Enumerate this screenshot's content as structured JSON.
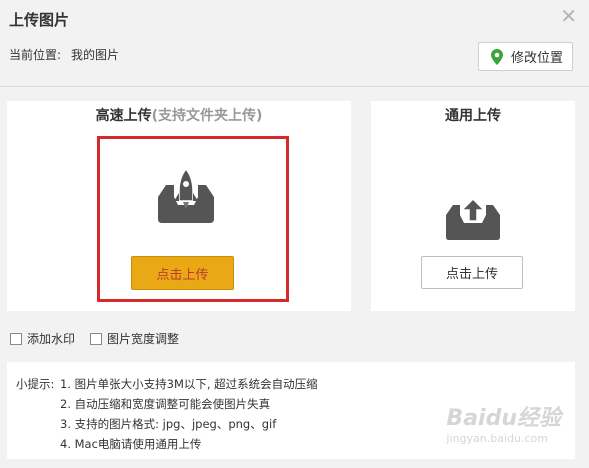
{
  "dialog": {
    "title": "上传图片",
    "close_glyph": "✕"
  },
  "location": {
    "label": "当前位置:",
    "value": "我的图片",
    "modify_label": "修改位置",
    "pin_icon": "map-pin-icon",
    "pin_color": "#3aa33a"
  },
  "fast_upload": {
    "title": "高速上传",
    "subtitle": "(支持文件夹上传)",
    "button_label": "点击上传",
    "icon": "rocket-upload-icon",
    "button_color": "#e8a915",
    "highlight_color": "#d42a2a"
  },
  "normal_upload": {
    "title": "通用上传",
    "button_label": "点击上传",
    "icon": "tray-upload-icon"
  },
  "options": {
    "watermark_label": "添加水印",
    "width_adjust_label": "图片宽度调整"
  },
  "tips": {
    "lead": "小提示:",
    "lines": [
      "1. 图片单张大小支持3M以下, 超过系统会自动压缩",
      "2. 自动压缩和宽度调整可能会使图片失真",
      "3. 支持的图片格式: jpg、jpeg、png、gif",
      "4. Mac电脑请使用通用上传"
    ]
  },
  "watermark": {
    "text": "Baidu经验",
    "sub": "jingyan.baidu.com"
  }
}
